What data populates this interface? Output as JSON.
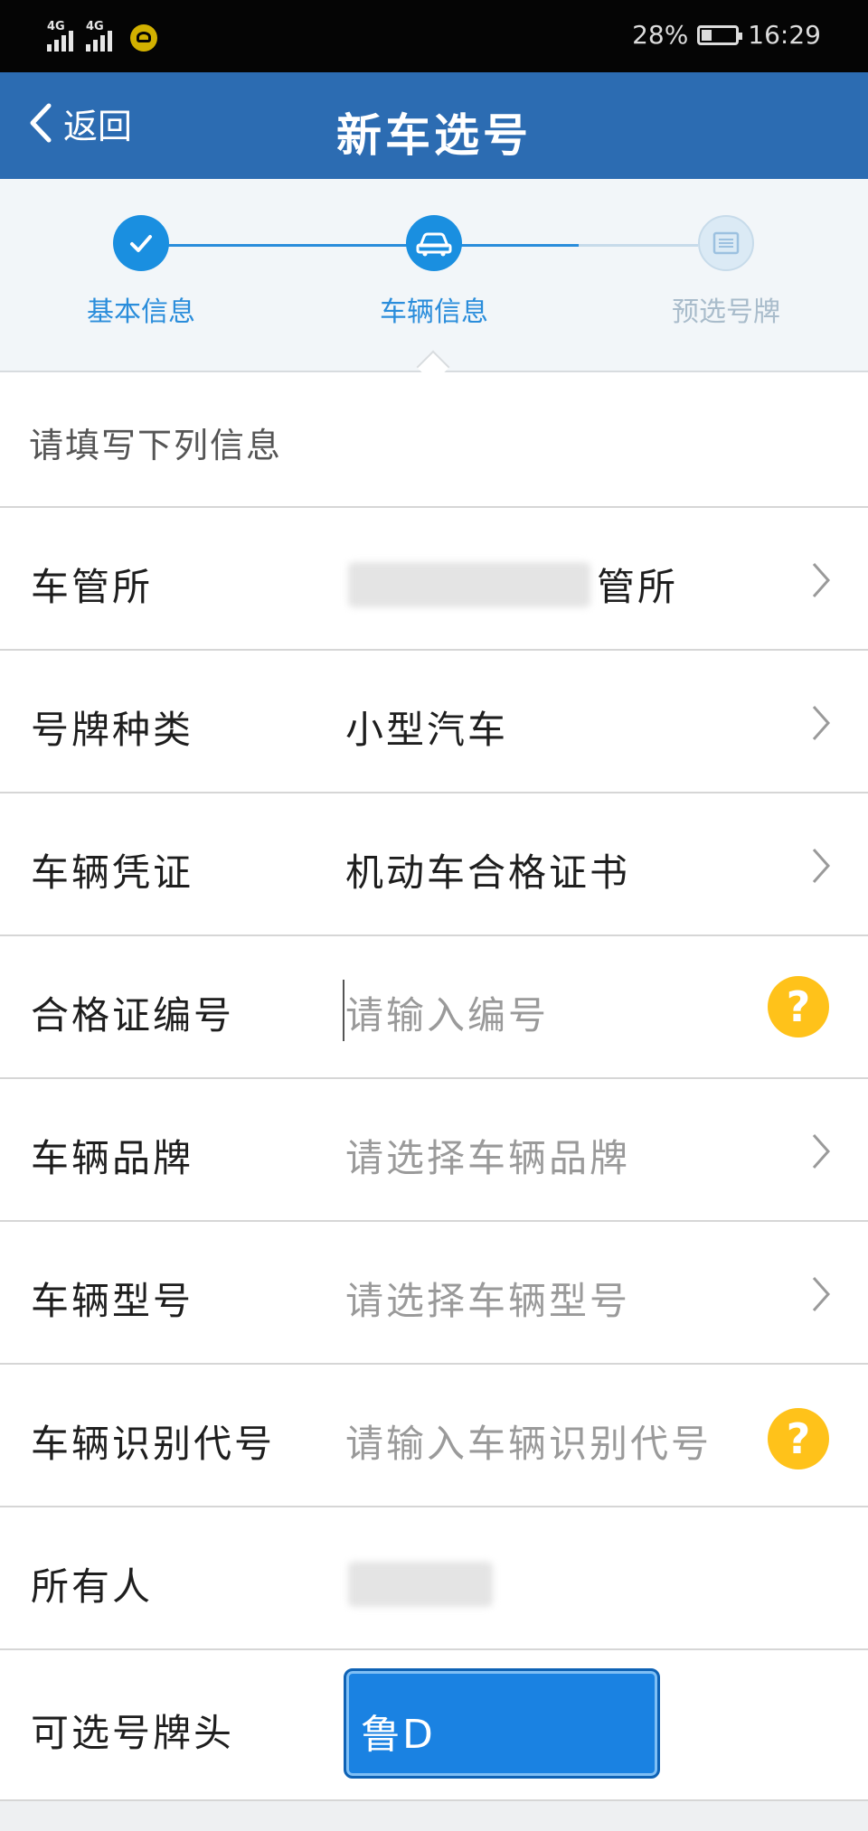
{
  "status_bar": {
    "network1": "4G",
    "network2": "4G",
    "battery": "28%",
    "time": "16:29"
  },
  "nav": {
    "back_label": "返回",
    "title": "新车选号"
  },
  "steps": [
    {
      "label": "基本信息",
      "state": "done"
    },
    {
      "label": "车辆信息",
      "state": "active"
    },
    {
      "label": "预选号牌",
      "state": "pending"
    }
  ],
  "intro": "请填写下列信息",
  "form": {
    "office": {
      "label": "车管所",
      "value": "管所"
    },
    "plate_type": {
      "label": "号牌种类",
      "value": "小型汽车"
    },
    "voucher": {
      "label": "车辆凭证",
      "value": "机动车合格证书"
    },
    "cert_no": {
      "label": "合格证编号",
      "placeholder": "请输入编号"
    },
    "brand": {
      "label": "车辆品牌",
      "placeholder": "请选择车辆品牌"
    },
    "model": {
      "label": "车辆型号",
      "placeholder": "请选择车辆型号"
    },
    "vin": {
      "label": "车辆识别代号",
      "placeholder": "请输入车辆识别代号"
    },
    "owner": {
      "label": "所有人"
    },
    "plate_prefix": {
      "label": "可选号牌头",
      "value": "鲁D"
    }
  },
  "colors": {
    "primary": "#2c6cb2",
    "accent": "#1a8fe0",
    "help": "#ffc21a",
    "plate": "#1a82e2"
  }
}
